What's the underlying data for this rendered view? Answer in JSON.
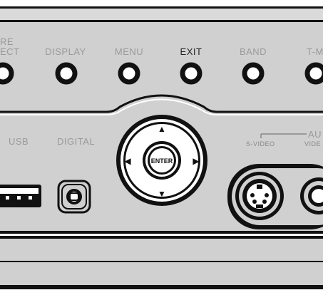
{
  "buttons": {
    "pure_direct": {
      "label_top": "RE",
      "label_bottom": "ECT"
    },
    "display": "DISPLAY",
    "menu": "MENU",
    "exit": "EXIT",
    "band": "BAND",
    "tmode": "T-MO"
  },
  "ports": {
    "usb": "USB",
    "digital": "DIGITAL",
    "audio_group": "AU",
    "svideo": "S-VIDEO",
    "video": "VIDE"
  },
  "dpad": {
    "enter": "ENTER",
    "up_glyph": "▲",
    "down_glyph": "▼",
    "left_glyph": "◀",
    "right_glyph": "▶"
  },
  "colors": {
    "panel": "#cfcfcf",
    "dark": "#111111",
    "label": "#9a9a9a",
    "highlight_label": "#222222"
  }
}
